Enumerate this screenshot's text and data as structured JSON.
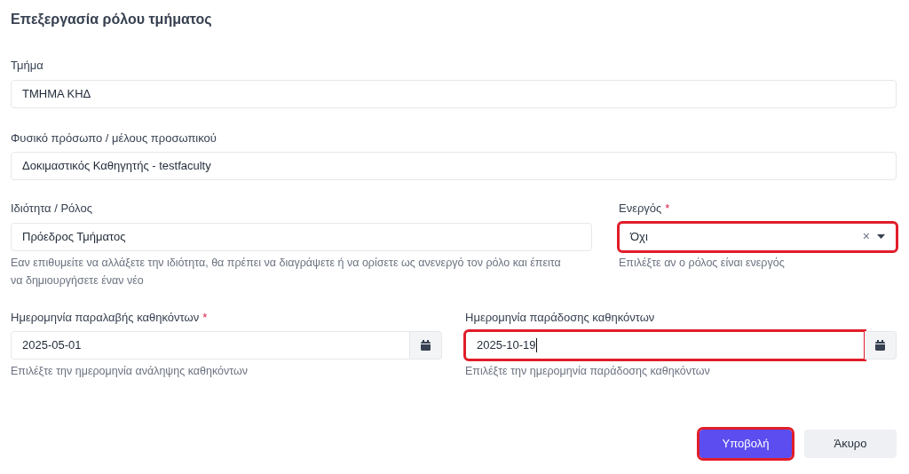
{
  "title": "Επεξεργασία ρόλου τμήματος",
  "fields": [
    {
      "kind": "text",
      "label": "Τμήμα",
      "value": "ΤΜΗΜΑ ΚΗΔ",
      "highlighted": false
    },
    {
      "kind": "text",
      "label": "Φυσικό πρόσωπο / μέλους προσωπικού",
      "value": "Δοκιμαστικός Καθηγητής - testfaculty",
      "highlighted": false
    }
  ],
  "row_role": [
    {
      "kind": "text",
      "label": "Ιδιότητα / Ρόλος",
      "value": "Πρόεδρος Τμήματος",
      "help": "Εαν επιθυμείτε να αλλάξετε την ιδιότητα, θα πρέπει να διαγράψετε ή να ορίσετε ως ανενεργό τον ρόλο και έπειτα να δημιουργήσετε έναν νέο",
      "highlighted": false
    },
    {
      "kind": "select",
      "label": "Ενεργός",
      "required_mark": "*",
      "value": "Όχι",
      "clear": "×",
      "help": "Επιλέξτε αν ο ρόλος είναι ενεργός",
      "highlighted": true
    }
  ],
  "row_dates": [
    {
      "kind": "date",
      "label": "Ημερομηνία παραλαβής καθηκόντων",
      "required_mark": "*",
      "value": "2025-05-01",
      "help": "Επιλέξτε την ημερομηνία ανάληψης καθηκόντων",
      "highlighted": false
    },
    {
      "kind": "date",
      "label": "Ημερομηνία παράδοσης καθηκόντων",
      "value": "2025-10-19",
      "help": "Επιλέξτε την ημερομηνία παράδοσης καθηκόντων",
      "highlighted": true
    }
  ],
  "buttons": [
    {
      "kind": "primary",
      "label": "Υποβολή",
      "highlighted": true
    },
    {
      "kind": "secondary",
      "label": "Άκυρο",
      "highlighted": false
    }
  ]
}
